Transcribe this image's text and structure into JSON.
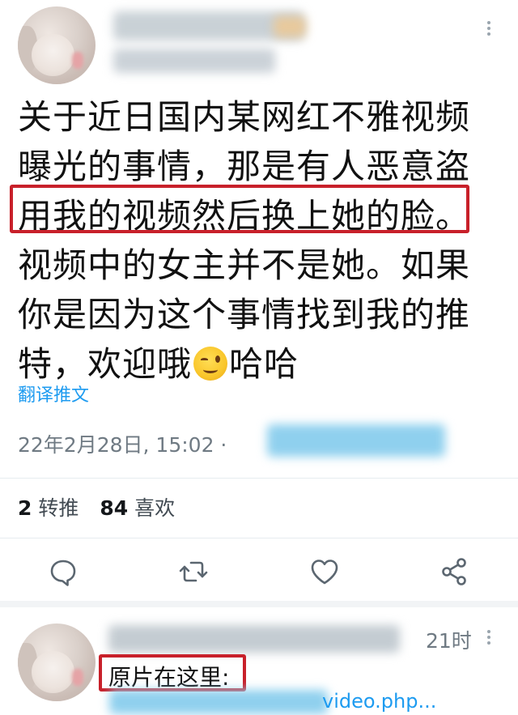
{
  "tweet": {
    "lines": [
      "关于近日国内某网红不雅视频",
      "曝光的事情，那是有人恶意盗",
      "用我的视频然后换上她的脸。",
      "视频中的女主并不是她。如果",
      "你是因为这个事情找到我的推",
      "特，欢迎哦"
    ],
    "line6_suffix": "哈哈",
    "emoji": "winking-face",
    "translate_label": "翻译推文",
    "timestamp": "22年2月28日, 15:02 ·"
  },
  "stats": {
    "retweets_count": "2",
    "retweets_label": "转推",
    "likes_count": "84",
    "likes_label": "喜欢"
  },
  "actions": [
    "reply-icon",
    "retweet-icon",
    "like-icon",
    "share-icon"
  ],
  "reply": {
    "time": "21时",
    "text": "原片在这里:",
    "link_text": "video.php..."
  },
  "colors": {
    "highlight_box": "#c8202a",
    "link": "#1d9bf0",
    "secondary_text": "#6f7a83",
    "blur_blue": "#8fd0ee"
  }
}
